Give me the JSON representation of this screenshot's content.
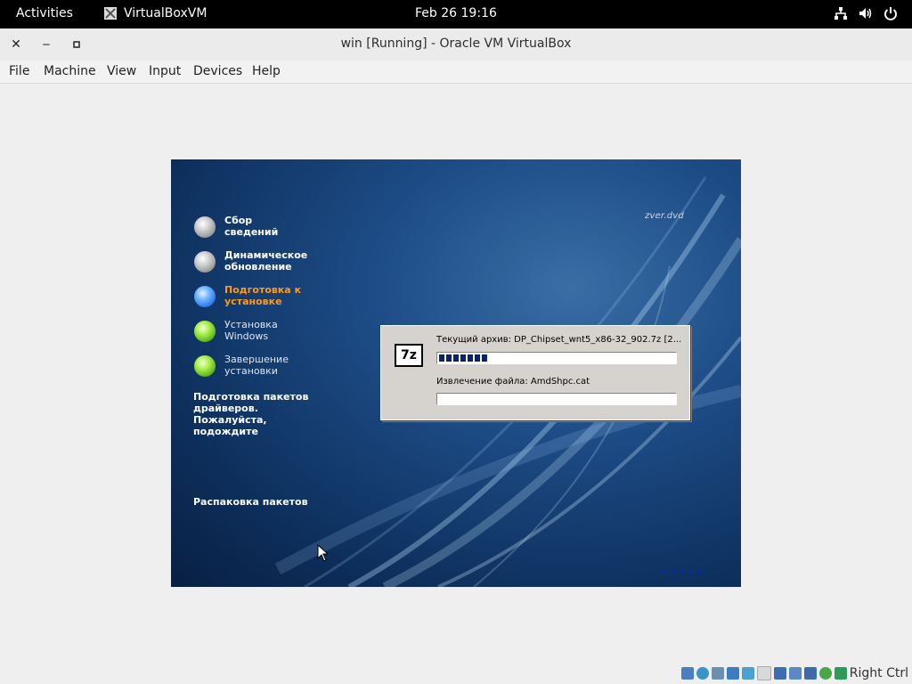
{
  "topbar": {
    "activities": "Activities",
    "app_name": "VirtualBoxVM",
    "clock": "Feb 26  19:16",
    "tray_icons": [
      "network-icon",
      "volume-icon",
      "power-icon"
    ]
  },
  "window": {
    "title": "win [Running] - Oracle VM VirtualBox",
    "controls": [
      "close",
      "minimize",
      "maximize"
    ]
  },
  "menubar": {
    "file": "File",
    "machine": "Machine",
    "view": "View",
    "input": "Input",
    "devices": "Devices",
    "help": "Help"
  },
  "vm": {
    "logo": "zver.dvd",
    "steps": [
      {
        "label": "Сбор сведений",
        "state": "done"
      },
      {
        "label": "Динамическое обновление",
        "state": "done"
      },
      {
        "label": "Подготовка к установке",
        "state": "active"
      },
      {
        "label": "Установка Windows",
        "state": "todo"
      },
      {
        "label": "Завершение установки",
        "state": "todo"
      }
    ],
    "status_text": "Подготовка пакетов драйверов. Пожалуйста, подождите",
    "unpack_text": "Распаковка пакетов",
    "dialog": {
      "icon_text": "7z",
      "archive_label": "Текущий архив: DP_Chipset_wnt5_x86-32_902.7z  [2...",
      "archive_progress": 0.22,
      "file_label": "Извлечение файла: AmdShpc.cat",
      "file_progress": 0
    }
  },
  "statusbar": {
    "host_key": "Right Ctrl"
  }
}
